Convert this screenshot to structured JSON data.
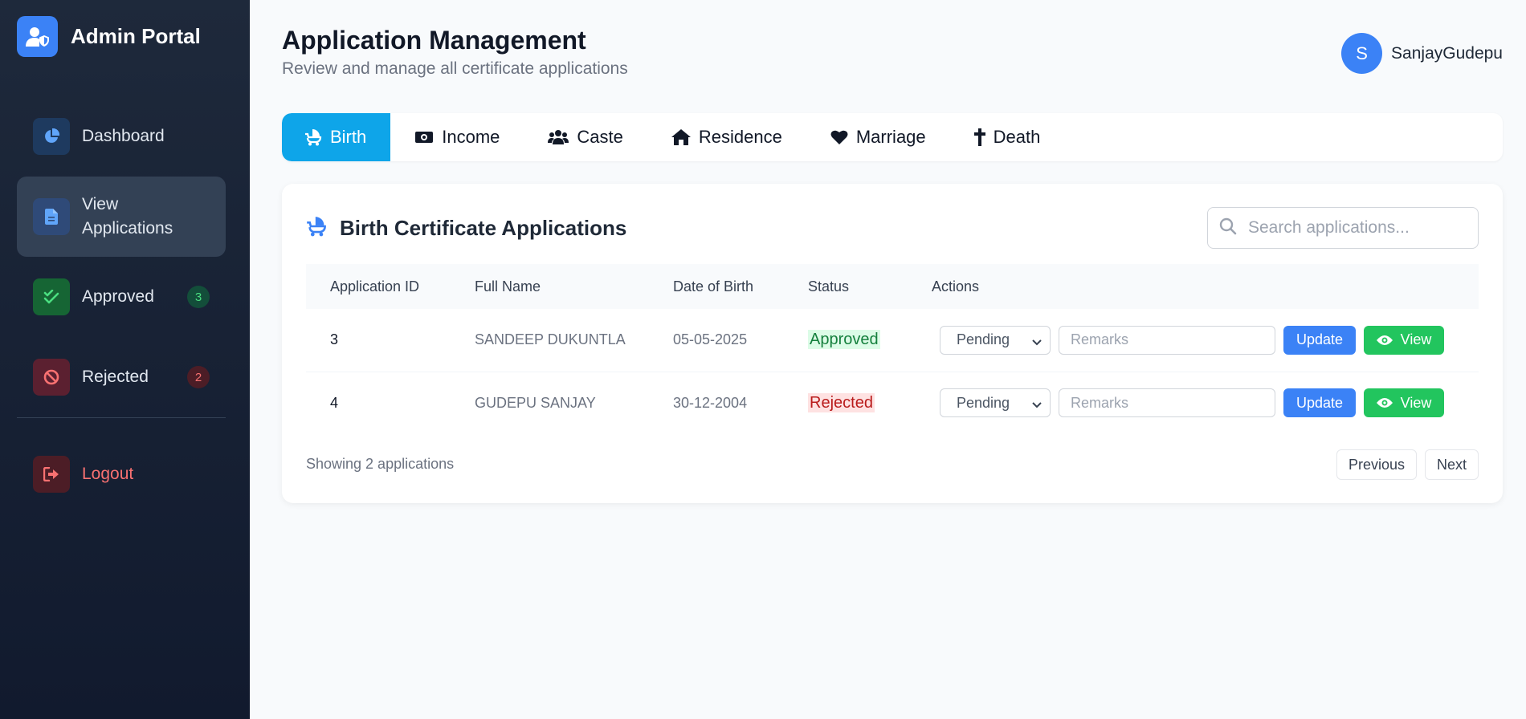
{
  "brand": {
    "title": "Admin Portal",
    "icon": "user-shield-icon"
  },
  "sidebar": {
    "items": [
      {
        "label": "Dashboard",
        "icon": "chart-pie-icon",
        "badge": null,
        "active": false
      },
      {
        "label": "View Applications",
        "icon": "file-icon",
        "badge": null,
        "active": true
      },
      {
        "label": "Approved",
        "icon": "check-double-icon",
        "badge": "3",
        "active": false
      },
      {
        "label": "Rejected",
        "icon": "ban-icon",
        "badge": "2",
        "active": false
      }
    ],
    "logout": {
      "label": "Logout",
      "icon": "sign-out-icon"
    }
  },
  "header": {
    "title": "Application Management",
    "subtitle": "Review and manage all certificate applications"
  },
  "user": {
    "initial": "S",
    "name": "SanjayGudepu"
  },
  "tabs": [
    {
      "label": "Birth",
      "icon": "baby-carriage-icon",
      "active": true
    },
    {
      "label": "Income",
      "icon": "money-bill-icon",
      "active": false
    },
    {
      "label": "Caste",
      "icon": "users-icon",
      "active": false
    },
    {
      "label": "Residence",
      "icon": "home-icon",
      "active": false
    },
    {
      "label": "Marriage",
      "icon": "heart-icon",
      "active": false
    },
    {
      "label": "Death",
      "icon": "cross-icon",
      "active": false
    }
  ],
  "card": {
    "title": "Birth Certificate Applications",
    "search_placeholder": "Search applications..."
  },
  "table": {
    "columns": [
      "Application ID",
      "Full Name",
      "Date of Birth",
      "Status",
      "Actions"
    ],
    "rows": [
      {
        "id": "3",
        "name": "SANDEEP DUKUNTLA",
        "dob": "05-05-2025",
        "status": "Approved",
        "select": "Pending",
        "remarks_placeholder": "Remarks",
        "update": "Update",
        "view": "View"
      },
      {
        "id": "4",
        "name": "GUDEPU SANJAY",
        "dob": "30-12-2004",
        "status": "Rejected",
        "select": "Pending",
        "remarks_placeholder": "Remarks",
        "update": "Update",
        "view": "View"
      }
    ]
  },
  "footer": {
    "showing": "Showing 2 applications",
    "previous": "Previous",
    "next": "Next"
  },
  "colors": {
    "accent": "#3b82f6",
    "tab_active": "#0ea5e9",
    "approved": "#15803d",
    "rejected": "#b91c1c",
    "view_button": "#22c55e"
  }
}
